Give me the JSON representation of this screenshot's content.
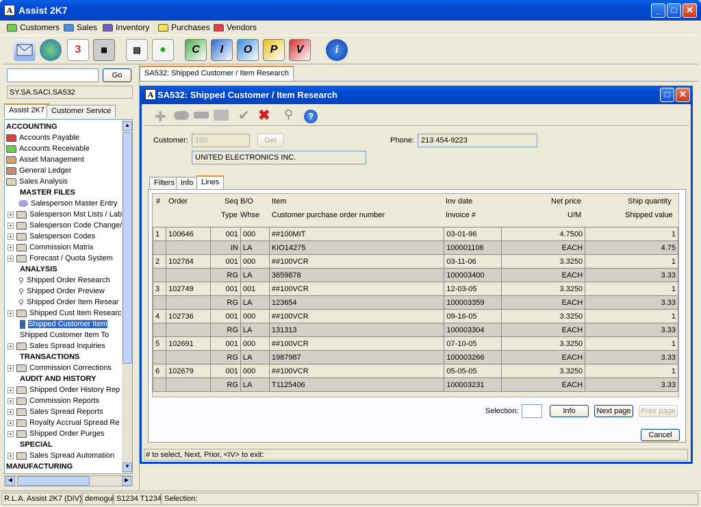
{
  "app": {
    "title": "Assist 2K7"
  },
  "menu": [
    {
      "label": "Customers",
      "color": "#6fcf4f"
    },
    {
      "label": "Sales",
      "color": "#4f8de0"
    },
    {
      "label": "Inventory",
      "color": "#6d5fc2"
    },
    {
      "label": "Purchases",
      "color": "#f0e060"
    },
    {
      "label": "Vendors",
      "color": "#e04040"
    }
  ],
  "toolbar": {
    "letters": [
      "C",
      "I",
      "O",
      "P",
      "V"
    ],
    "letter_colors": [
      "#4caf50",
      "#2e6bd1",
      "#3a8be0",
      "#e8c020",
      "#d83030"
    ]
  },
  "left": {
    "go_label": "Go",
    "path": "SY.SA.SACI.SA532",
    "tabs": [
      "Assist 2K7",
      "Customer Service"
    ]
  },
  "tree": [
    {
      "label": "ACCOUNTING",
      "kind": "hdr"
    },
    {
      "label": "Accounts Payable",
      "kind": "folder",
      "color": "#e04040"
    },
    {
      "label": "Accounts Receivable",
      "kind": "folder",
      "color": "#6fcf4f"
    },
    {
      "label": "Asset Management",
      "kind": "folder",
      "color": "#d9a070"
    },
    {
      "label": "General Ledger",
      "kind": "folder",
      "color": "#c09070"
    },
    {
      "label": "Sales Analysis",
      "kind": "folder",
      "color": "#d9d4c0"
    },
    {
      "label": "MASTER FILES",
      "kind": "hdr2"
    },
    {
      "label": "Salesperson Master Entry",
      "kind": "item"
    },
    {
      "label": "Salesperson Mst Lists / Lab",
      "kind": "sub"
    },
    {
      "label": "Salesperson Code Change/",
      "kind": "sub"
    },
    {
      "label": "Salesperson Codes",
      "kind": "sub"
    },
    {
      "label": "Commission Matrix",
      "kind": "sub"
    },
    {
      "label": "Forecast / Quota System",
      "kind": "sub"
    },
    {
      "label": "ANALYSIS",
      "kind": "hdr2"
    },
    {
      "label": "Shipped Order Research",
      "kind": "search"
    },
    {
      "label": "Shipped Order Preview",
      "kind": "search"
    },
    {
      "label": "Shipped Order Item Resear",
      "kind": "search"
    },
    {
      "label": "Shipped Cust Item Researc",
      "kind": "sub"
    },
    {
      "label": "Shipped Customer Item",
      "kind": "selected"
    },
    {
      "label": "Shipped Customer Item To",
      "kind": "leaf"
    },
    {
      "label": "Sales Spread Inquiries",
      "kind": "sub"
    },
    {
      "label": "TRANSACTIONS",
      "kind": "hdr2"
    },
    {
      "label": "Commission Corrections",
      "kind": "sub"
    },
    {
      "label": "AUDIT AND HISTORY",
      "kind": "hdr2"
    },
    {
      "label": "Shipped Order History Rep",
      "kind": "sub"
    },
    {
      "label": "Commission Reports",
      "kind": "sub"
    },
    {
      "label": "Sales Spread Reports",
      "kind": "sub"
    },
    {
      "label": "Royalty Accrual Spread Re",
      "kind": "sub"
    },
    {
      "label": "Shipped Order Purges",
      "kind": "sub"
    },
    {
      "label": "SPECIAL",
      "kind": "hdr2"
    },
    {
      "label": "Sales Spread Automation",
      "kind": "sub"
    },
    {
      "label": "MANUFACTURING",
      "kind": "hdr"
    }
  ],
  "doc_tab": "SA532: Shipped Customer / Item Research",
  "dialog": {
    "title": "SA532: Shipped Customer / Item Research",
    "customer_label": "Customer:",
    "customer_value": "100",
    "get_label": "Get",
    "phone_label": "Phone:",
    "phone_value": "213 454-9223",
    "customer_name": "UNITED ELECTRONICS INC.",
    "tabs": [
      "Filters",
      "Info",
      "Lines"
    ],
    "headers1": [
      "#",
      "Order",
      "Seq",
      "B/O",
      "Item",
      "Inv date",
      "Net price",
      "Ship quantity"
    ],
    "headers2": [
      "Type",
      "Whse",
      "Customer purchase order number",
      "Invoice #",
      "U/M",
      "Shipped value"
    ],
    "selection_label": "Selection:",
    "info_label": "Info",
    "next_label": "Next page",
    "prior_label": "Prior page",
    "cancel_label": "Cancel",
    "hint": "# to select,  Next,  Prior,  <IV> to exit:"
  },
  "lines": [
    {
      "n": "1",
      "order": "100646",
      "seq": "001",
      "bo": "000",
      "item": "##100MIT",
      "invdate": "03-01-96",
      "price": "4.7500",
      "qty": "1",
      "type": "IN",
      "whse": "LA",
      "po": "KIO14275",
      "inv": "100001106",
      "um": "EACH",
      "val": "4.75"
    },
    {
      "n": "2",
      "order": "102784",
      "seq": "001",
      "bo": "000",
      "item": "##100VCR",
      "invdate": "03-11-06",
      "price": "3.3250",
      "qty": "1",
      "type": "RG",
      "whse": "LA",
      "po": "3659878",
      "inv": "100003400",
      "um": "EACH",
      "val": "3.33"
    },
    {
      "n": "3",
      "order": "102749",
      "seq": "001",
      "bo": "001",
      "item": "##100VCR",
      "invdate": "12-03-05",
      "price": "3.3250",
      "qty": "1",
      "type": "RG",
      "whse": "LA",
      "po": "123654",
      "inv": "100003359",
      "um": "EACH",
      "val": "3.33"
    },
    {
      "n": "4",
      "order": "102736",
      "seq": "001",
      "bo": "000",
      "item": "##100VCR",
      "invdate": "09-16-05",
      "price": "3.3250",
      "qty": "1",
      "type": "RG",
      "whse": "LA",
      "po": "131313",
      "inv": "100003304",
      "um": "EACH",
      "val": "3.33"
    },
    {
      "n": "5",
      "order": "102691",
      "seq": "001",
      "bo": "000",
      "item": "##100VCR",
      "invdate": "07-10-05",
      "price": "3.3250",
      "qty": "1",
      "type": "RG",
      "whse": "LA",
      "po": "1987987",
      "inv": "100003266",
      "um": "EACH",
      "val": "3.33"
    },
    {
      "n": "6",
      "order": "102679",
      "seq": "001",
      "bo": "000",
      "item": "##100VCR",
      "invdate": "05-05-05",
      "price": "3.3250",
      "qty": "1",
      "type": "RG",
      "whse": "LA",
      "po": "T1125406",
      "inv": "100003231",
      "um": "EACH",
      "val": "3.33"
    }
  ],
  "status": [
    "R.L.A. Assist 2K7 (DIV)",
    "demogui",
    "S1234 T1234",
    "Selection:"
  ]
}
